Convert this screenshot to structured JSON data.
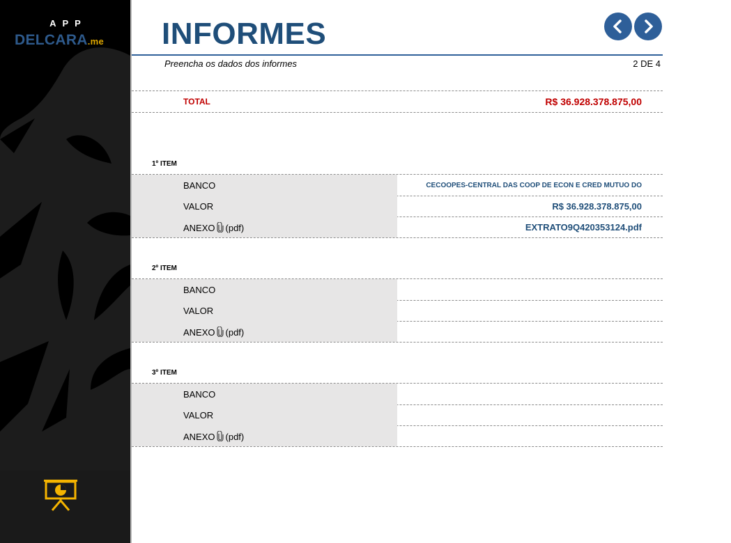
{
  "brand": {
    "app": "APP",
    "name": "DELCARA",
    "suffix": ".me"
  },
  "header": {
    "title": "INFORMES",
    "subtitle": "Preencha os dados dos informes",
    "page_indicator": "2 DE 4"
  },
  "total": {
    "label": "TOTAL",
    "value": "R$ 36.928.378.875,00"
  },
  "items": [
    {
      "title": "1º ITEM",
      "banco_label": "BANCO",
      "banco_value": "CECOOPES-CENTRAL DAS COOP DE ECON E CRED MUTUO DO",
      "valor_label": "VALOR",
      "valor_value": "R$ 36.928.378.875,00",
      "anexo_label": "ANEXO",
      "anexo_suffix": "(pdf)",
      "anexo_value": "EXTRATO9Q420353124.pdf"
    },
    {
      "title": "2º ITEM",
      "banco_label": "BANCO",
      "banco_value": "",
      "valor_label": "VALOR",
      "valor_value": "",
      "anexo_label": "ANEXO",
      "anexo_suffix": "(pdf)",
      "anexo_value": ""
    },
    {
      "title": "3º ITEM",
      "banco_label": "BANCO",
      "banco_value": "",
      "valor_label": "VALOR",
      "valor_value": "",
      "anexo_label": "ANEXO",
      "anexo_suffix": "(pdf)",
      "anexo_value": ""
    }
  ],
  "icons": {
    "nav_prev": "chevron-left-icon",
    "nav_next": "chevron-right-icon",
    "attachment": "paperclip-icon",
    "presentation": "presentation-chart-icon"
  },
  "colors": {
    "title": "#1f4e79",
    "accent": "#2e5f99",
    "total": "#c00000",
    "label_bg": "#e7e6e6",
    "icon_yellow": "#f5b400"
  }
}
